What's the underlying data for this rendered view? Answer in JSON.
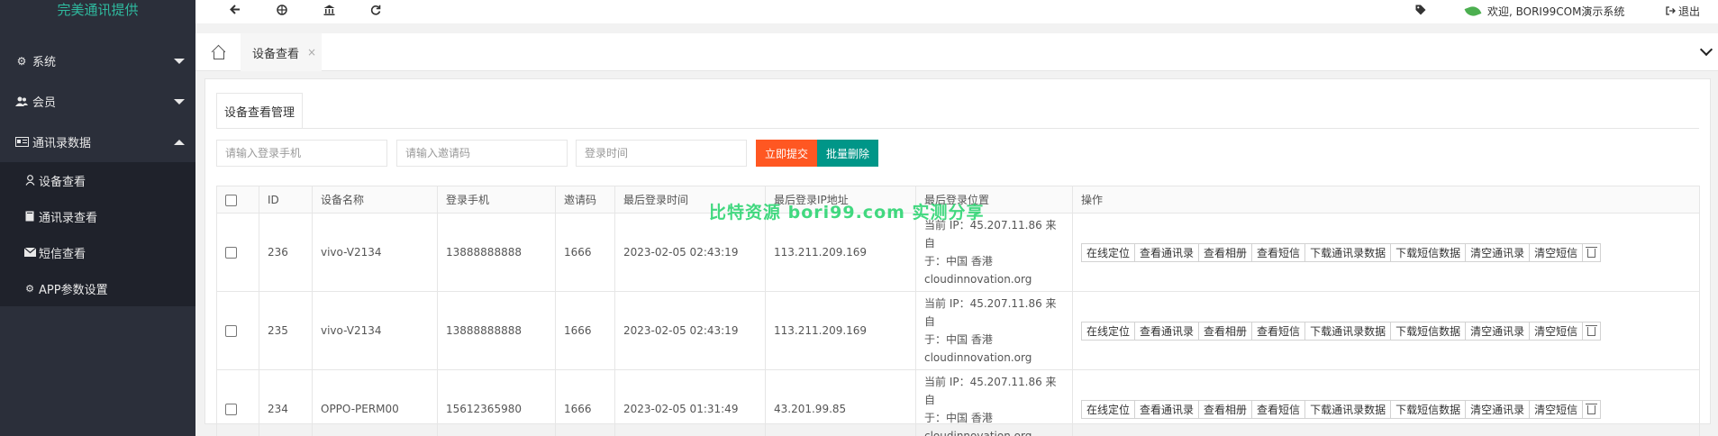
{
  "brand": "完美通讯提供",
  "sidebar": {
    "items": [
      {
        "label": "系统",
        "icon": "gear-icon"
      },
      {
        "label": "会员",
        "icon": "users-icon"
      },
      {
        "label": "通讯录数据",
        "icon": "id-card-icon"
      }
    ],
    "subitems": [
      {
        "label": "设备查看",
        "icon": "user-icon"
      },
      {
        "label": "通讯录查看",
        "icon": "book-icon"
      },
      {
        "label": "短信查看",
        "icon": "envelope-icon"
      },
      {
        "label": "APP参数设置",
        "icon": "gear-icon"
      }
    ]
  },
  "header": {
    "welcome": "欢迎, BORI99COM演示系统",
    "logout": "退出"
  },
  "tabs": {
    "active": "设备查看",
    "close": "×"
  },
  "panel": {
    "title": "设备查看管理"
  },
  "filters": {
    "phone_placeholder": "请输入登录手机",
    "code_placeholder": "请输入邀请码",
    "time_placeholder": "登录时间",
    "submit_label": "立即提交",
    "batch_delete_label": "批量删除"
  },
  "colors": {
    "submit": "#ff5722",
    "batch": "#009688",
    "sidebar": "#2b2f3a",
    "brand": "#2fb99e"
  },
  "table": {
    "headers": [
      "ID",
      "设备名称",
      "登录手机",
      "邀请码",
      "最后登录时间",
      "最后登录IP地址",
      "最后登录位置",
      "操作"
    ],
    "rows": [
      {
        "id": "236",
        "device": "vivo-V2134",
        "phone": "13888888888",
        "code": "1666",
        "time": "2023-02-05 02:43:19",
        "ip": "113.211.209.169",
        "loc1": "当前 IP：45.207.11.86 来自",
        "loc2": "于：中国 香港",
        "loc3": "cloudinnovation.org"
      },
      {
        "id": "235",
        "device": "vivo-V2134",
        "phone": "13888888888",
        "code": "1666",
        "time": "2023-02-05 02:43:19",
        "ip": "113.211.209.169",
        "loc1": "当前 IP：45.207.11.86 来自",
        "loc2": "于：中国 香港",
        "loc3": "cloudinnovation.org"
      },
      {
        "id": "234",
        "device": "OPPO-PERM00",
        "phone": "15612365980",
        "code": "1666",
        "time": "2023-02-05 01:31:49",
        "ip": "43.201.99.85",
        "loc1": "当前 IP：45.207.11.86 来自",
        "loc2": "于：中国 香港",
        "loc3": "cloudinnovation.org"
      }
    ],
    "actions": [
      "在线定位",
      "查看通讯录",
      "查看相册",
      "查看短信",
      "下载通讯录数据",
      "下载短信数据",
      "清空通讯录",
      "清空短信"
    ]
  },
  "watermark": "比特资源 bori99.com 实测分享"
}
